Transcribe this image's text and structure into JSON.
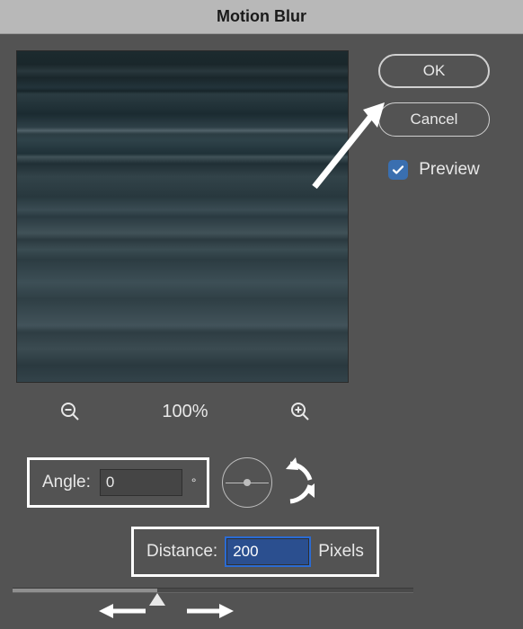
{
  "title": "Motion Blur",
  "buttons": {
    "ok": "OK",
    "cancel": "Cancel"
  },
  "preview": {
    "label": "Preview",
    "checked": true
  },
  "zoom": {
    "level": "100%"
  },
  "angle": {
    "label": "Angle:",
    "value": "0",
    "unit": "°"
  },
  "distance": {
    "label": "Distance:",
    "value": "200",
    "unit": "Pixels"
  },
  "icons": {
    "zoom_out": "zoom-out-icon",
    "zoom_in": "zoom-in-icon",
    "check": "check-icon"
  }
}
